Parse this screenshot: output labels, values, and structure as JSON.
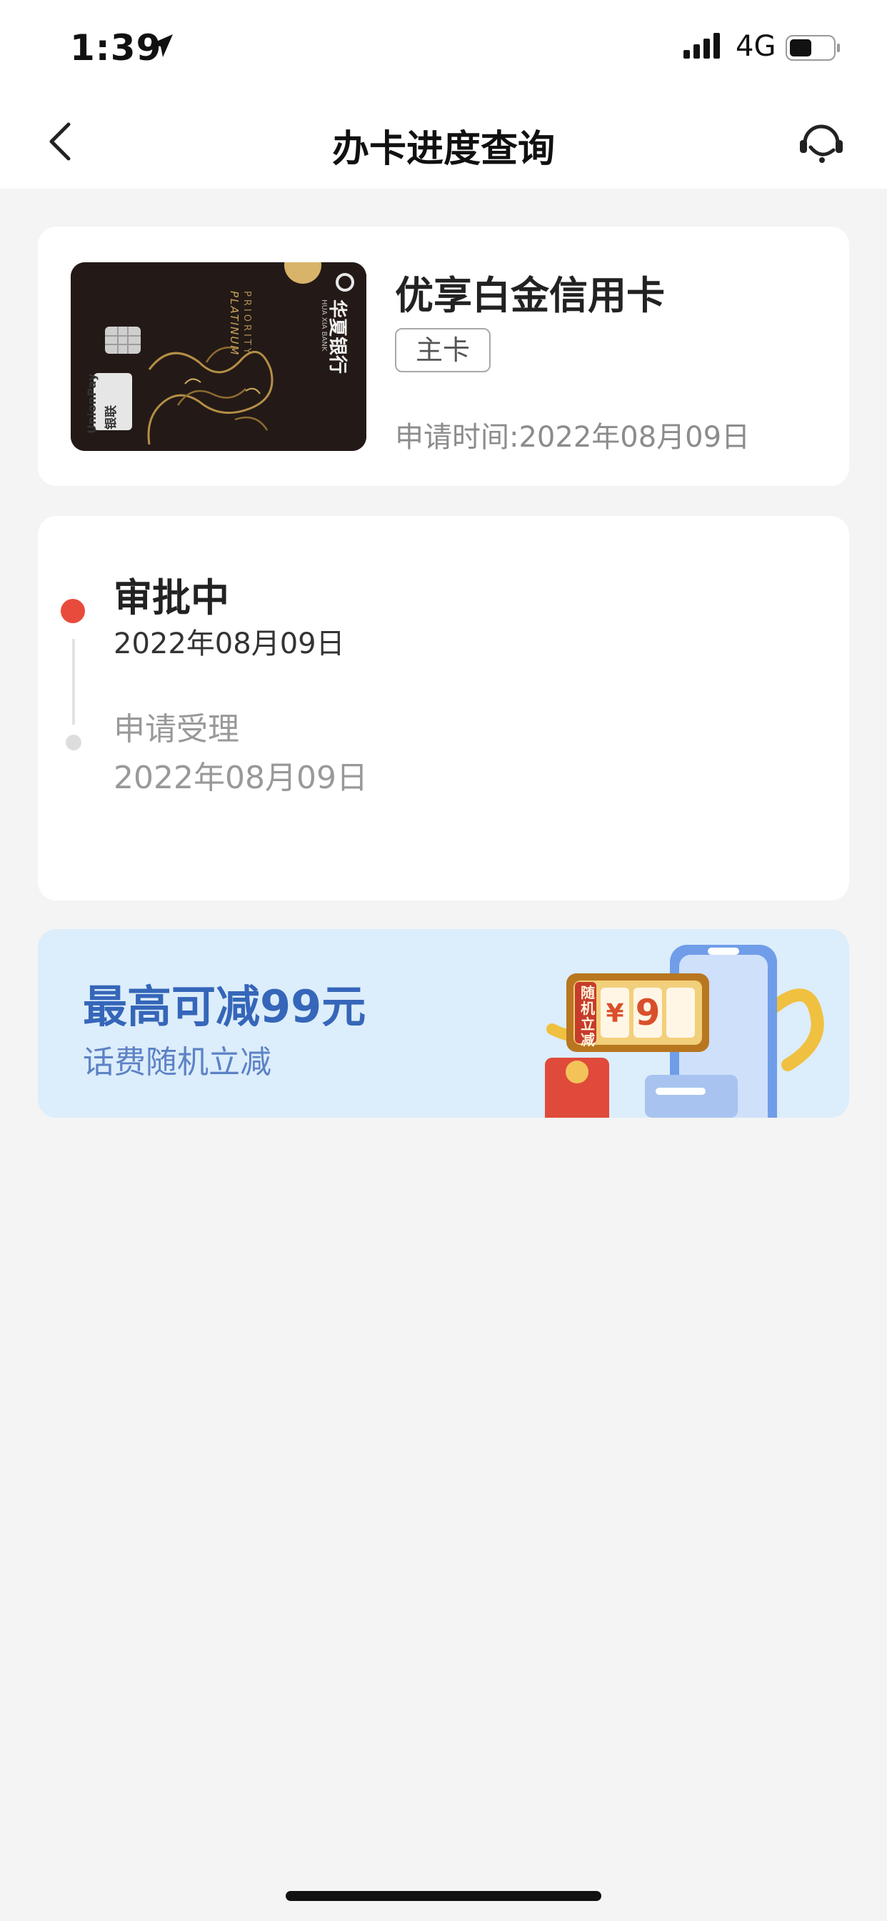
{
  "status_bar": {
    "time": "1:39",
    "network": "4G",
    "icons": [
      "location-arrow-icon",
      "signal-bars-icon",
      "battery-icon"
    ]
  },
  "nav": {
    "title": "办卡进度查询",
    "back_icon": "chevron-left-icon",
    "service_icon": "customer-service-headset-icon"
  },
  "card": {
    "product_name": "优享白金信用卡",
    "tag": "主卡",
    "apply_time": "申请时间:2022年08月09日",
    "card_face": {
      "bank_name": "华夏银行",
      "bank_name_en": "HUA XIA BANK",
      "tier_line1": "PRIORITY",
      "tier_line2": "PLATINUM",
      "network": "UnionPay",
      "network_cn": "银联"
    }
  },
  "progress": {
    "steps": [
      {
        "status": "审批中",
        "date": "2022年08月09日",
        "active": true
      },
      {
        "status": "申请受理",
        "date": "2022年08月09日",
        "active": false
      }
    ]
  },
  "banner": {
    "title": "最高可减99元",
    "subtitle": "话费随机立减",
    "slot_label": "随机立减",
    "slot_currency": "¥",
    "slot_digit": "9"
  },
  "colors": {
    "accent_red": "#e84b3c",
    "banner_blue": "#3566b9",
    "banner_bg": "#dcedfb"
  }
}
